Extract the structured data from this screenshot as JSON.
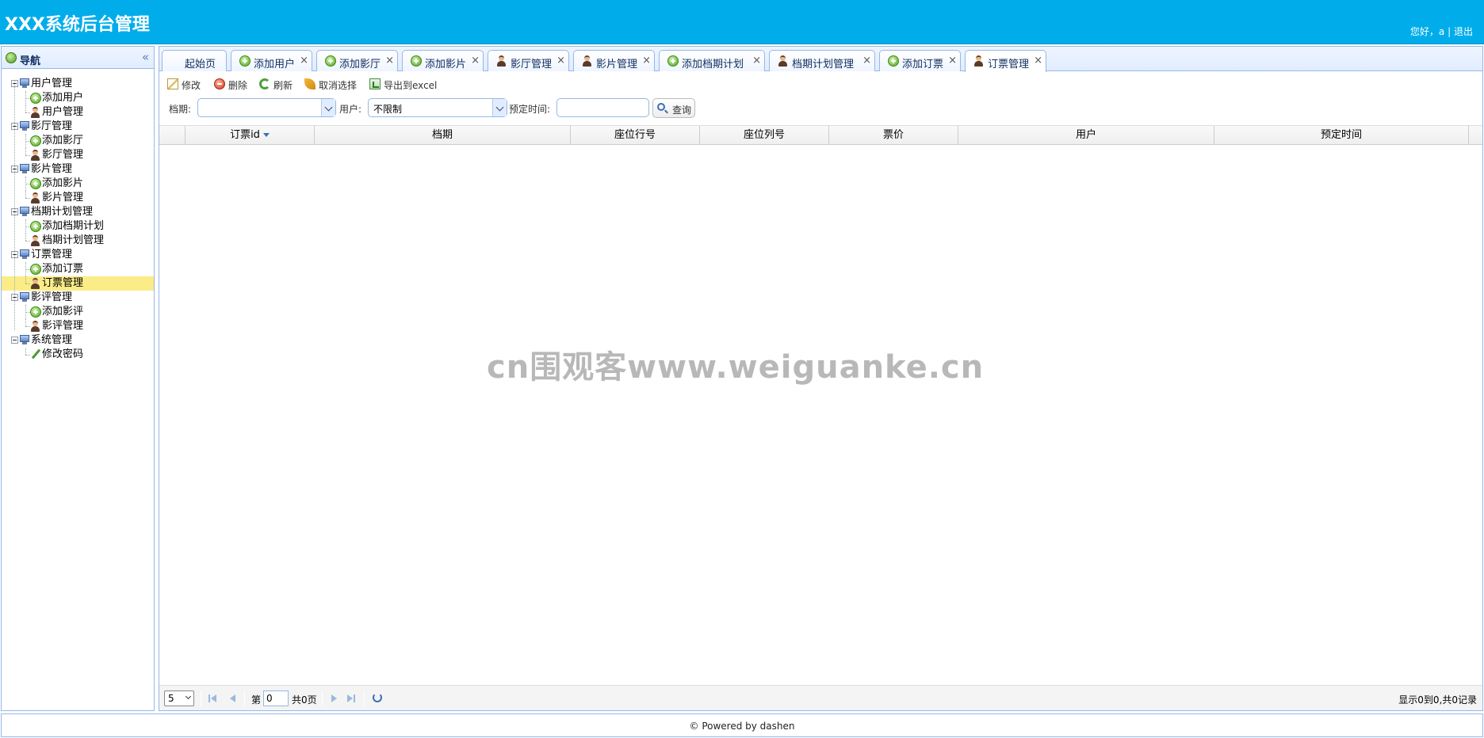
{
  "header": {
    "title": "XXX系统后台管理",
    "greeting": "您好，a",
    "separator": "|",
    "logout": "退出"
  },
  "nav": {
    "title": "导航",
    "collapse_glyph": "«",
    "groups": [
      {
        "label": "用户管理",
        "icon": "monitor-icon",
        "items": [
          {
            "label": "添加用户",
            "icon": "add-icon"
          },
          {
            "label": "用户管理",
            "icon": "user-icon"
          }
        ]
      },
      {
        "label": "影厅管理",
        "icon": "monitor-icon",
        "items": [
          {
            "label": "添加影厅",
            "icon": "add-icon"
          },
          {
            "label": "影厅管理",
            "icon": "user-icon"
          }
        ]
      },
      {
        "label": "影片管理",
        "icon": "monitor-icon",
        "items": [
          {
            "label": "添加影片",
            "icon": "add-icon"
          },
          {
            "label": "影片管理",
            "icon": "user-icon"
          }
        ]
      },
      {
        "label": "档期计划管理",
        "icon": "monitor-icon",
        "items": [
          {
            "label": "添加档期计划",
            "icon": "add-icon"
          },
          {
            "label": "档期计划管理",
            "icon": "user-icon"
          }
        ]
      },
      {
        "label": "订票管理",
        "icon": "monitor-icon",
        "items": [
          {
            "label": "添加订票",
            "icon": "add-icon"
          },
          {
            "label": "订票管理",
            "icon": "user-icon",
            "selected": true
          }
        ]
      },
      {
        "label": "影评管理",
        "icon": "monitor-icon",
        "items": [
          {
            "label": "添加影评",
            "icon": "add-icon"
          },
          {
            "label": "影评管理",
            "icon": "user-icon"
          }
        ]
      },
      {
        "label": "系统管理",
        "icon": "monitor-icon",
        "items": [
          {
            "label": "修改密码",
            "icon": "pencil-icon"
          }
        ]
      }
    ]
  },
  "tabs": [
    {
      "label": "起始页",
      "icon": "",
      "closable": false
    },
    {
      "label": "添加用户",
      "icon": "add-icon",
      "closable": true
    },
    {
      "label": "添加影厅",
      "icon": "add-icon",
      "closable": true
    },
    {
      "label": "添加影片",
      "icon": "add-icon",
      "closable": true
    },
    {
      "label": "影厅管理",
      "icon": "user-icon",
      "closable": true
    },
    {
      "label": "影片管理",
      "icon": "user-icon",
      "closable": true
    },
    {
      "label": "添加档期计划",
      "icon": "add-icon",
      "closable": true
    },
    {
      "label": "档期计划管理",
      "icon": "user-icon",
      "closable": true
    },
    {
      "label": "添加订票",
      "icon": "add-icon",
      "closable": true
    },
    {
      "label": "订票管理",
      "icon": "user-icon",
      "closable": true,
      "active": true
    }
  ],
  "tab_close_glyph": "×",
  "toolbar": {
    "edit": "修改",
    "delete": "删除",
    "refresh": "刷新",
    "cancel_select": "取消选择",
    "export": "导出到excel"
  },
  "search": {
    "schedule_label": "档期:",
    "schedule_value": "",
    "user_label": "用户:",
    "user_value": "不限制",
    "time_label": "预定时间:",
    "time_value": "",
    "query": "查询"
  },
  "grid": {
    "columns": [
      "订票id",
      "档期",
      "座位行号",
      "座位列号",
      "票价",
      "用户",
      "预定时间"
    ],
    "sort_column": "订票id",
    "rows": []
  },
  "watermark": "cn围观客www.weiguanke.cn",
  "pager": {
    "page_size": "5",
    "page_label_before": "第",
    "page_value": "0",
    "page_label_after": "共0页",
    "info": "显示0到0,共0记录"
  },
  "footer": "© Powered by dashen",
  "colors": {
    "header_bg": "#00adea",
    "panel_border": "#95b8e7",
    "selected_row": "#fbec88"
  }
}
